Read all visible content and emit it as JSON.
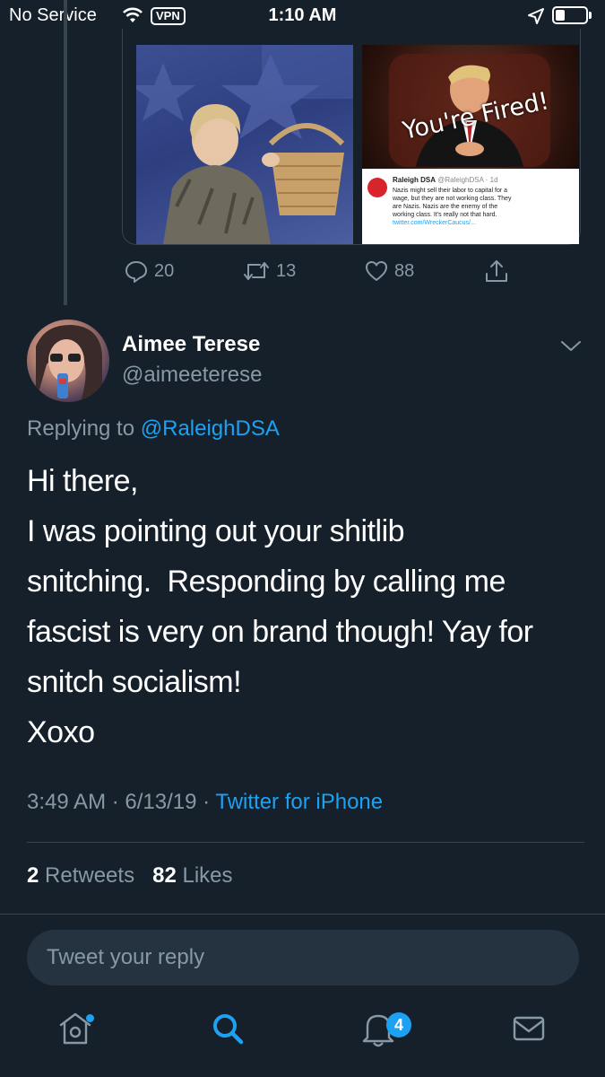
{
  "status_bar": {
    "carrier": "No Service",
    "vpn": "VPN",
    "time": "1:10 AM"
  },
  "quoted_media": {
    "right_caption": "You're Fired!",
    "embedded_tweet": {
      "name": "Raleigh DSA",
      "meta": "@RaleighDSA · 1d",
      "lines": [
        "Nazis might sell their labor to capital for a",
        "wage, but they are not working class. They",
        "are Nazis. Nazis are the enemy of the",
        "working class. It's really not that hard.",
        "twitter.com/WreckerCaucus/..."
      ]
    }
  },
  "prev_actions": {
    "replies": "20",
    "retweets": "13",
    "likes": "88"
  },
  "tweet": {
    "name": "Aimee Terese",
    "handle": "@aimeeterese",
    "replying_prefix": "Replying to ",
    "replying_to": "@RaleighDSA",
    "lines": [
      "Hi there,",
      "I was pointing out your shitlib",
      "snitching.  Responding by calling me",
      "fascist is very on brand though! Yay for",
      "snitch socialism!",
      "Xoxo"
    ],
    "time": "3:49 AM",
    "sep1": " · ",
    "date": "6/13/19",
    "sep2": " · ",
    "source": "Twitter for iPhone",
    "retweets_count": "2",
    "retweets_label": "Retweets",
    "likes_count": "82",
    "likes_label": "Likes"
  },
  "reply_box": {
    "placeholder": "Tweet your reply"
  },
  "tab_bar": {
    "notifications_badge": "4"
  },
  "colors": {
    "background": "#15202b",
    "accent": "#1da1f2",
    "secondary_text": "#8899a6",
    "divider": "#38444d"
  }
}
